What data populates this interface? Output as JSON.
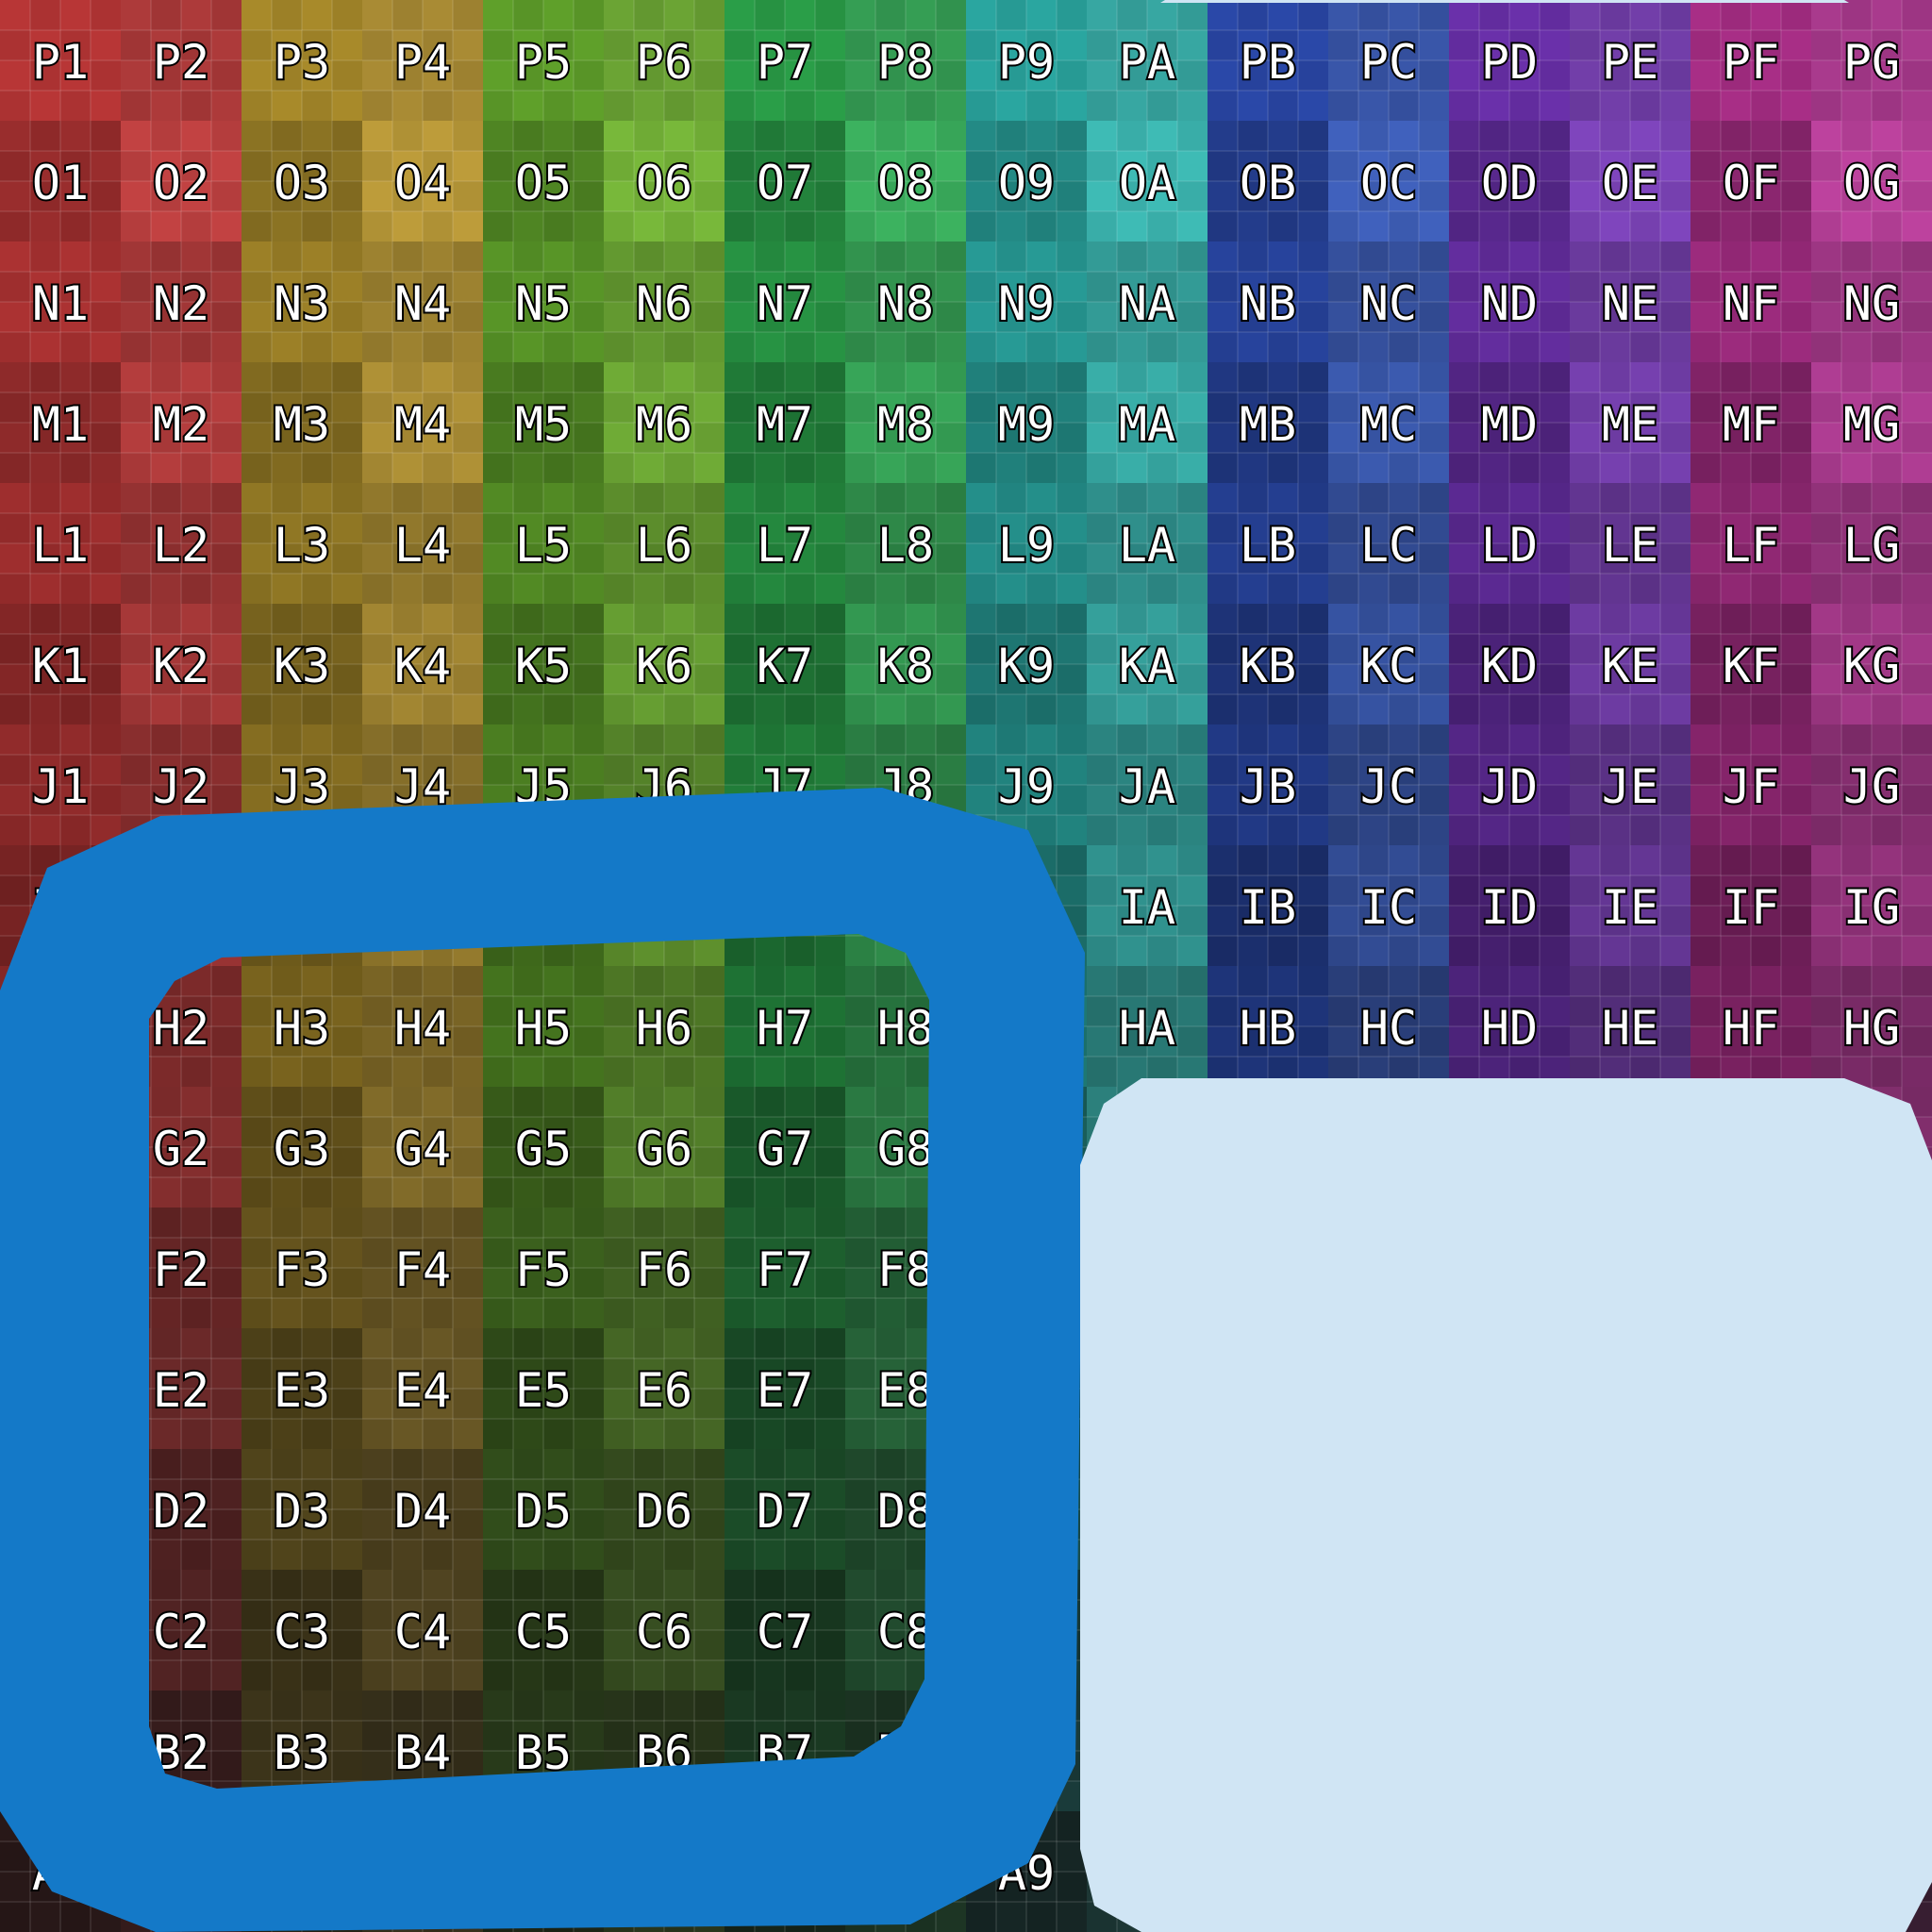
{
  "texture": {
    "rows": [
      "P",
      "O",
      "N",
      "M",
      "L",
      "K",
      "J",
      "I",
      "H",
      "G",
      "F",
      "E",
      "D",
      "C",
      "B",
      "A"
    ],
    "cols": [
      "1",
      "2",
      "3",
      "4",
      "5",
      "6",
      "7",
      "8",
      "9",
      "A",
      "B",
      "C",
      "D",
      "E",
      "F",
      "G"
    ],
    "column_colors": [
      "#b83636",
      "#c94444",
      "#a88a2a",
      "#c4a23c",
      "#5fa02a",
      "#7cbf3c",
      "#2a9e48",
      "#3eb862",
      "#2aa6a0",
      "#40c2bc",
      "#2a48a8",
      "#4264c4",
      "#6a30aa",
      "#8448c4",
      "#a82e86",
      "#c444a4"
    ],
    "shade_top": "#ffffff",
    "shade_bottom": "#000000"
  },
  "shapes": {
    "ring_color": "#1479c8",
    "panel_color": "#d0e5f4"
  }
}
